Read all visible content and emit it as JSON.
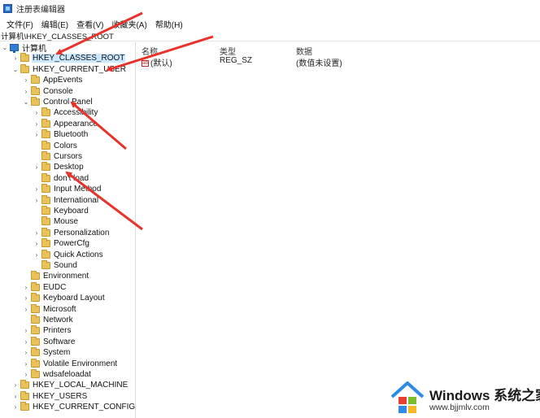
{
  "window": {
    "title": "注册表编辑器"
  },
  "menu": [
    "文件(F)",
    "编辑(E)",
    "查看(V)",
    "收藏夹(A)",
    "帮助(H)"
  ],
  "address": "计算机\\HKEY_CLASSES_ROOT",
  "tree": [
    {
      "label": "计算机",
      "level": 0,
      "chev": "v",
      "icon": "pc"
    },
    {
      "label": "HKEY_CLASSES_ROOT",
      "level": 1,
      "chev": ">",
      "selected": true
    },
    {
      "label": "HKEY_CURRENT_USER",
      "level": 1,
      "chev": "v"
    },
    {
      "label": "AppEvents",
      "level": 2,
      "chev": ">"
    },
    {
      "label": "Console",
      "level": 2,
      "chev": ">"
    },
    {
      "label": "Control Panel",
      "level": 2,
      "chev": "v"
    },
    {
      "label": "Accessibility",
      "level": 3,
      "chev": ">"
    },
    {
      "label": "Appearance",
      "level": 3,
      "chev": ">"
    },
    {
      "label": "Bluetooth",
      "level": 3,
      "chev": ">"
    },
    {
      "label": "Colors",
      "level": 3,
      "chev": ""
    },
    {
      "label": "Cursors",
      "level": 3,
      "chev": ""
    },
    {
      "label": "Desktop",
      "level": 3,
      "chev": ">"
    },
    {
      "label": "don't load",
      "level": 3,
      "chev": ""
    },
    {
      "label": "Input Method",
      "level": 3,
      "chev": ">"
    },
    {
      "label": "International",
      "level": 3,
      "chev": ">"
    },
    {
      "label": "Keyboard",
      "level": 3,
      "chev": ""
    },
    {
      "label": "Mouse",
      "level": 3,
      "chev": ""
    },
    {
      "label": "Personalization",
      "level": 3,
      "chev": ">"
    },
    {
      "label": "PowerCfg",
      "level": 3,
      "chev": ">"
    },
    {
      "label": "Quick Actions",
      "level": 3,
      "chev": ">"
    },
    {
      "label": "Sound",
      "level": 3,
      "chev": ""
    },
    {
      "label": "Environment",
      "level": 2,
      "chev": ""
    },
    {
      "label": "EUDC",
      "level": 2,
      "chev": ">"
    },
    {
      "label": "Keyboard Layout",
      "level": 2,
      "chev": ">"
    },
    {
      "label": "Microsoft",
      "level": 2,
      "chev": ">"
    },
    {
      "label": "Network",
      "level": 2,
      "chev": ""
    },
    {
      "label": "Printers",
      "level": 2,
      "chev": ">"
    },
    {
      "label": "Software",
      "level": 2,
      "chev": ">"
    },
    {
      "label": "System",
      "level": 2,
      "chev": ">"
    },
    {
      "label": "Volatile Environment",
      "level": 2,
      "chev": ">"
    },
    {
      "label": "wdsafeloadat",
      "level": 2,
      "chev": ">"
    },
    {
      "label": "HKEY_LOCAL_MACHINE",
      "level": 1,
      "chev": ">"
    },
    {
      "label": "HKEY_USERS",
      "level": 1,
      "chev": ">"
    },
    {
      "label": "HKEY_CURRENT_CONFIG",
      "level": 1,
      "chev": ">"
    }
  ],
  "columns": {
    "name": "名称",
    "type": "类型",
    "data": "数据"
  },
  "values": [
    {
      "name": "(默认)",
      "type": "REG_SZ",
      "data": "(数值未设置)",
      "icon": "ab"
    }
  ],
  "watermark": {
    "brand": "Windows 系统之家",
    "url": "www.bjjmlv.com"
  },
  "colors": {
    "selection": "#cce8ff",
    "arrow": "#e8322a",
    "folder": "#e9c25a"
  }
}
